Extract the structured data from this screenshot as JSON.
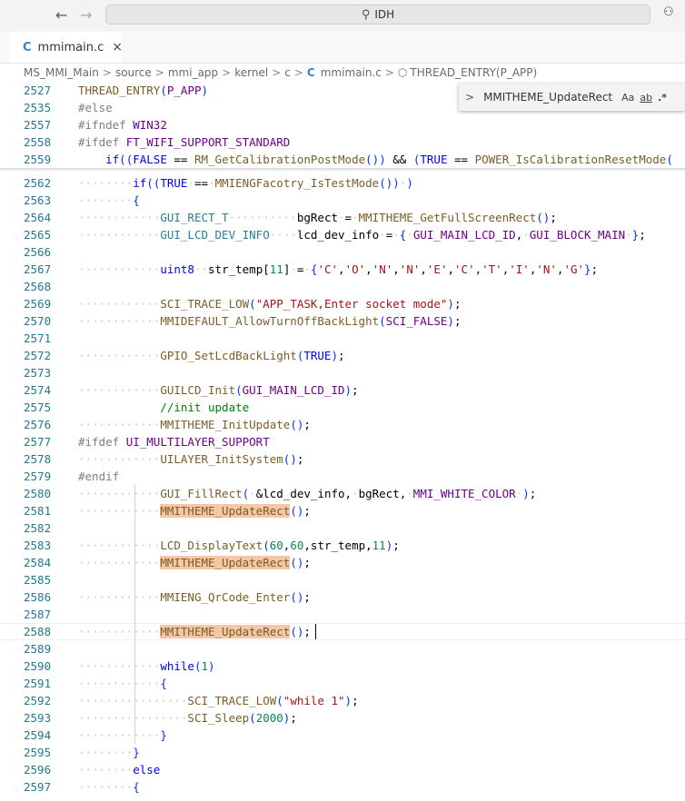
{
  "titlebar": {
    "search_text": "IDH",
    "back": "←",
    "forward": "→"
  },
  "tabs": [
    {
      "label": "mmimain.c",
      "icon": "C",
      "close": "×"
    }
  ],
  "breadcrumb": {
    "items": [
      "MS_MMI_Main",
      "source",
      "mmi_app",
      "kernel",
      "c",
      "mmimain.c",
      "THREAD_ENTRY(P_APP)"
    ],
    "sep": ">"
  },
  "find": {
    "query": "MMITHEME_UpdateRect",
    "opt_case": "Aa",
    "opt_word": "ab",
    "opt_regex": ".*"
  },
  "colors": {
    "accent": "#3b7fc9",
    "highlight": "#f5c7a7",
    "line_number": "#237893"
  },
  "editor": {
    "sticky_lines": [
      {
        "num": "2527",
        "text": "THREAD_ENTRY(P_APP)"
      },
      {
        "num": "2535",
        "text": "#else"
      },
      {
        "num": "2557",
        "text": "#ifndef WIN32"
      },
      {
        "num": "2558",
        "text": "#ifdef FT_WIFI_SUPPORT_STANDARD"
      },
      {
        "num": "2559",
        "text": "    if((FALSE == RM_GetCalibrationPostMode()) && (TRUE == POWER_IsCalibrationResetMode("
      }
    ],
    "lines": [
      {
        "num": "2562",
        "text": "        if((TRUE == MMIENGFacotry_IsTestMode()) )"
      },
      {
        "num": "2563",
        "text": "        {"
      },
      {
        "num": "2564",
        "text": "            GUI_RECT_T          bgRect = MMITHEME_GetFullScreenRect();"
      },
      {
        "num": "2565",
        "text": "            GUI_LCD_DEV_INFO    lcd_dev_info = { GUI_MAIN_LCD_ID, GUI_BLOCK_MAIN };"
      },
      {
        "num": "2566",
        "text": ""
      },
      {
        "num": "2567",
        "text": "            uint8  str_temp[11] = {'C','O','N','N','E','C','T','I','N','G'};"
      },
      {
        "num": "2568",
        "text": ""
      },
      {
        "num": "2569",
        "text": "            SCI_TRACE_LOW(\"APP_TASK,Enter socket mode\");"
      },
      {
        "num": "2570",
        "text": "            MMIDEFAULT_AllowTurnOffBackLight(SCI_FALSE);"
      },
      {
        "num": "2571",
        "text": ""
      },
      {
        "num": "2572",
        "text": "            GPIO_SetLcdBackLight(TRUE);"
      },
      {
        "num": "2573",
        "text": ""
      },
      {
        "num": "2574",
        "text": "            GUILCD_Init(GUI_MAIN_LCD_ID);"
      },
      {
        "num": "2575",
        "text": "            //init update"
      },
      {
        "num": "2576",
        "text": "            MMITHEME_InitUpdate();"
      },
      {
        "num": "2577",
        "text": "#ifdef UI_MULTILAYER_SUPPORT"
      },
      {
        "num": "2578",
        "text": "            UILAYER_InitSystem();"
      },
      {
        "num": "2579",
        "text": "#endif"
      },
      {
        "num": "2580",
        "text": "            GUI_FillRect( &lcd_dev_info, bgRect, MMI_WHITE_COLOR );"
      },
      {
        "num": "2581",
        "text": "            MMITHEME_UpdateRect();"
      },
      {
        "num": "2582",
        "text": ""
      },
      {
        "num": "2583",
        "text": "            LCD_DisplayText(60,60,str_temp,11);"
      },
      {
        "num": "2584",
        "text": "            MMITHEME_UpdateRect();"
      },
      {
        "num": "2585",
        "text": ""
      },
      {
        "num": "2586",
        "text": "            MMIENG_QrCode_Enter();"
      },
      {
        "num": "2587",
        "text": ""
      },
      {
        "num": "2588",
        "text": "            MMITHEME_UpdateRect();"
      },
      {
        "num": "2589",
        "text": ""
      },
      {
        "num": "2590",
        "text": "            while(1)"
      },
      {
        "num": "2591",
        "text": "            {"
      },
      {
        "num": "2592",
        "text": "                SCI_TRACE_LOW(\"while 1\");"
      },
      {
        "num": "2593",
        "text": "                SCI_Sleep(2000);"
      },
      {
        "num": "2594",
        "text": "            }"
      },
      {
        "num": "2595",
        "text": "        }"
      },
      {
        "num": "2596",
        "text": "        else"
      },
      {
        "num": "2597",
        "text": "        {"
      }
    ]
  }
}
